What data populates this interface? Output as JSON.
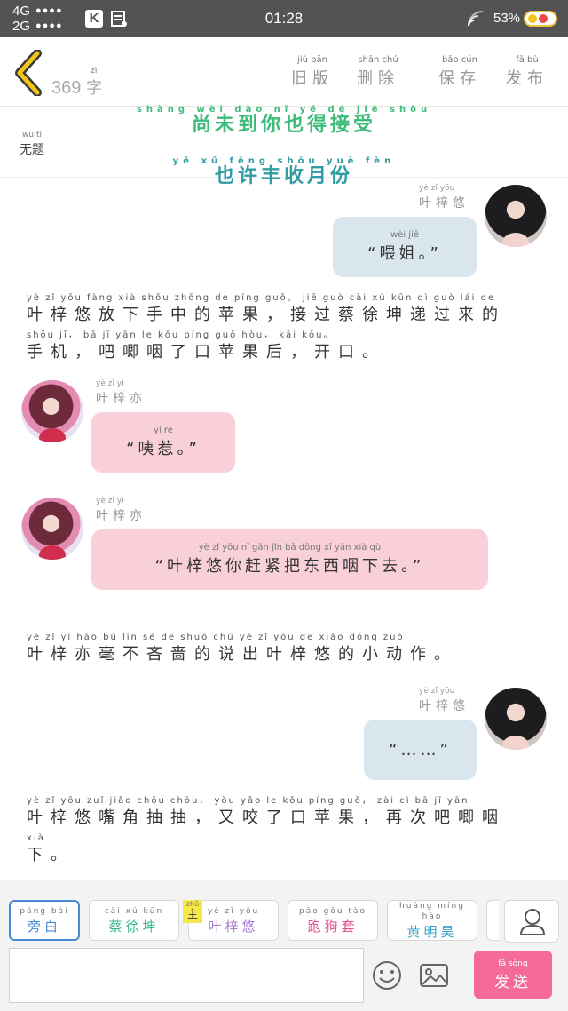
{
  "status_bar": {
    "net1": "4G",
    "net2": "2G",
    "dots": "●●●●",
    "app_icon_letter": "K",
    "time": "01:28",
    "battery": "53%"
  },
  "header": {
    "word_count": "369",
    "word_unit": "字",
    "word_unit_py": "zì",
    "buttons": [
      {
        "py": "jiù  bǎn",
        "label": "旧版"
      },
      {
        "py": "shān  chú",
        "label": "删除"
      },
      {
        "py": "bǎo  cún",
        "label": "保存"
      },
      {
        "py": "fā  bù",
        "label": "发布"
      }
    ]
  },
  "title": {
    "py": "wú  tí",
    "label": "无题",
    "banner1_py": "shàng wèi dào nǐ yě dé jiē shòu",
    "banner1": "尚未到你也得接受",
    "banner2_py": "yě xǔ fēng shōu yuè fèn",
    "banner2": "也许丰收月份"
  },
  "messages": [
    {
      "speaker_py": "yè  zǐ  yōu",
      "speaker": "叶梓悠",
      "text_py": "wèi  jiě",
      "text": "“喂姐。”"
    },
    {
      "narration": [
        {
          "py": "yè zǐ yōu fàng xià shǒu zhōng de píng guǒ， jiē guò cài xú kūn dì guò lái de",
          "text": "叶梓悠放下手中的苹果，接过蔡徐坤递过来的"
        },
        {
          "py": "shǒu jī， bā jī yān le kǒu píng guǒ hòu， kāi kǒu。",
          "text": "手机，吧唧咽了口苹果后，开口。"
        }
      ]
    },
    {
      "speaker_py": "yè  zǐ  yì",
      "speaker": "叶梓亦",
      "text_py": "yí  rě",
      "text": "“咦惹。”"
    },
    {
      "speaker_py": "yè  zǐ  yì",
      "speaker": "叶梓亦",
      "text_py": "yè zǐ yōu nǐ gǎn jǐn bǎ dōng xī yān xià qù",
      "text": "“叶梓悠你赶紧把东西咽下去。”"
    },
    {
      "narration": [
        {
          "py": "yè zǐ yì háo bù lìn sè de shuō chū yè zǐ yōu de xiǎo dòng zuò",
          "text": "叶梓亦毫不吝啬的说出叶梓悠的小动作。"
        }
      ]
    },
    {
      "speaker_py": "yè  zǐ  yōu",
      "speaker": "叶梓悠",
      "text": "“……”"
    },
    {
      "narration": [
        {
          "py": "yè zǐ yōu zuǐ jiǎo chōu chōu， yòu yǎo le kǒu píng guǒ， zài cì bā jī yān",
          "text": "叶梓悠嘴角抽抽，又咬了口苹果，再次吧唧咽"
        },
        {
          "py": "xià",
          "text": "下。"
        }
      ]
    }
  ],
  "characters": [
    {
      "py": "páng  bái",
      "label": "旁白",
      "color": "#4a8ad4"
    },
    {
      "py": "cài  xú  kūn",
      "label": "蔡徐坤",
      "color": "#3bb78f"
    },
    {
      "py": "yè  zǐ  yōu",
      "label": "叶梓悠",
      "color": "#a77bd6"
    },
    {
      "py": "pǎo  gǒu  tào",
      "label": "跑狗套",
      "color": "#e0508c"
    },
    {
      "py": "huáng míng hào",
      "label": "黄明昊",
      "color": "#3aa3c9"
    }
  ],
  "main_tag": {
    "py": "zhǔ",
    "label": "主"
  },
  "send": {
    "py": "fā  sòng",
    "label": "发送"
  },
  "colors": {
    "status_bg": "#535353",
    "bubble_blue": "#d9e6ee",
    "bubble_pink": "#f9d0da",
    "send_bg": "#f56a9b",
    "back_arrow": "#f2c617"
  }
}
